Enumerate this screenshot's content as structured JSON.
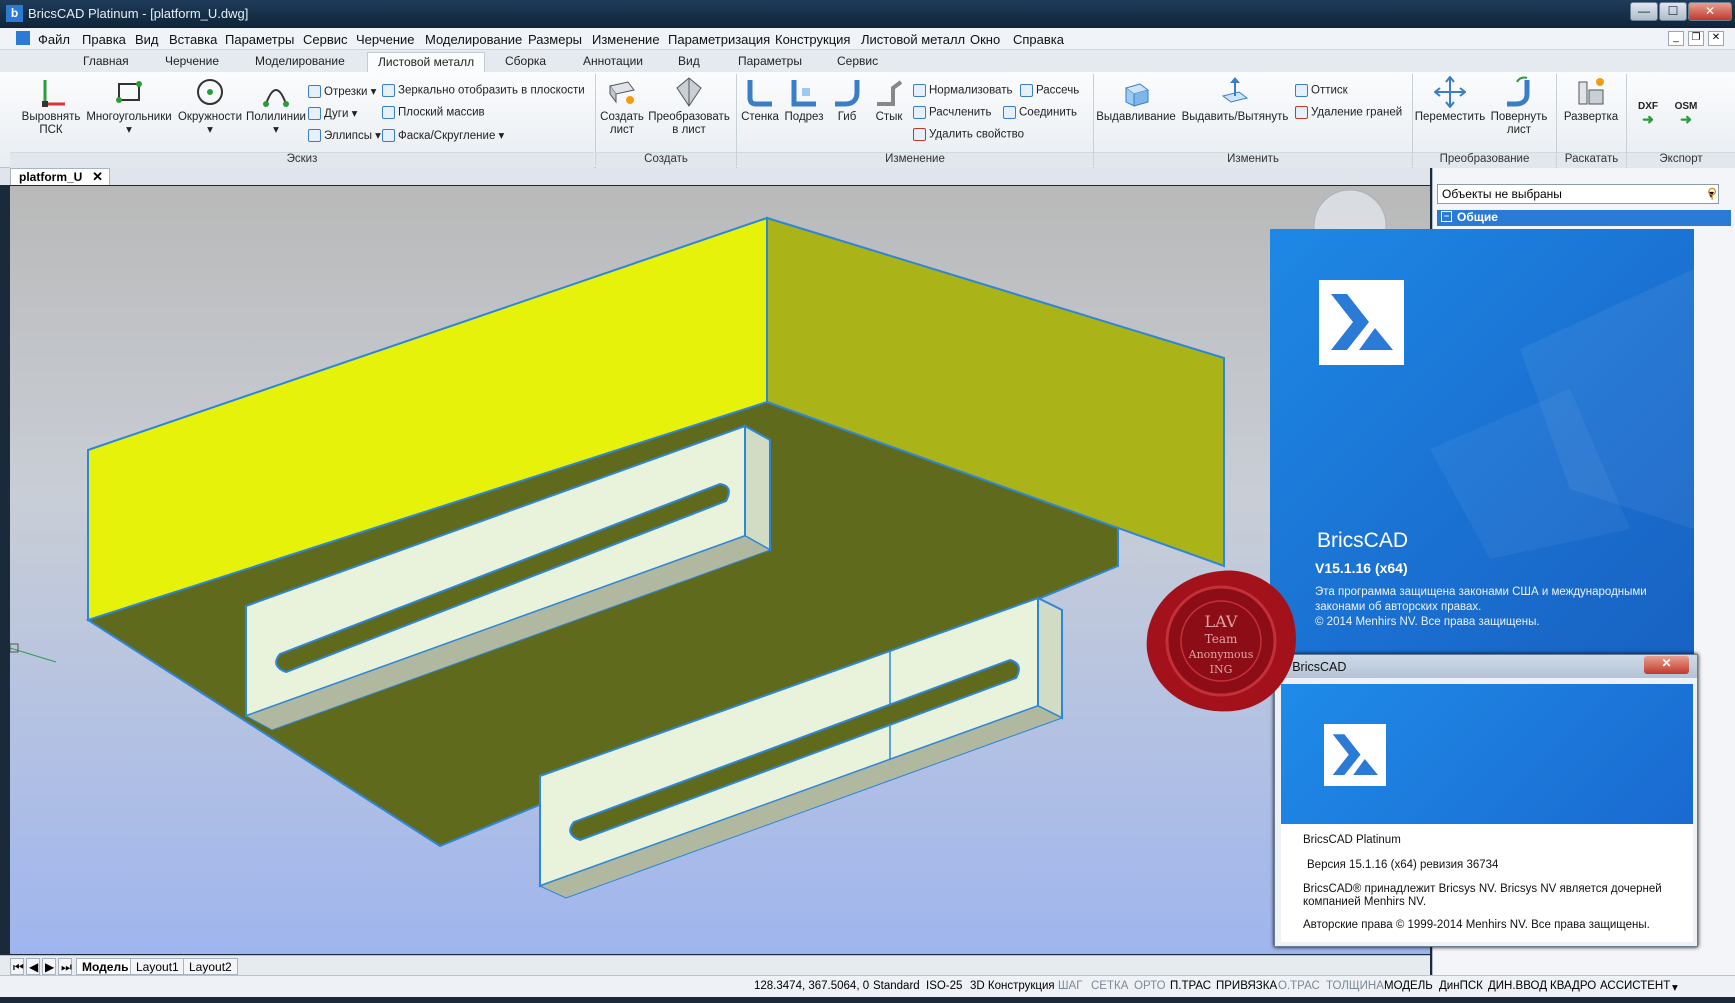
{
  "window": {
    "title": "BricsCAD Platinum - [platform_U.dwg]",
    "min": "—",
    "max": "☐",
    "close": "✕"
  },
  "menu": [
    "Файл",
    "Правка",
    "Вид",
    "Вставка",
    "Параметры",
    "Сервис",
    "Черчение",
    "Моделирование",
    "Размеры",
    "Изменение",
    "Параметризация",
    "Конструкция",
    "Листовой металл",
    "Окно",
    "Справка"
  ],
  "ribbon_tabs": [
    "Главная",
    "Черчение",
    "Моделирование",
    "Листовой металл",
    "Сборка",
    "Аннотации",
    "Вид",
    "Параметры",
    "Сервис"
  ],
  "ribbon": {
    "eskiz": {
      "group": "Эскиз",
      "align": "Выровнять ПСК",
      "polygons": "Многоугольники",
      "circles": "Окружности",
      "polylines": "Полилинии",
      "segments": "Отрезки",
      "arcs": "Дуги",
      "ellipses": "Эллипсы",
      "mirror": "Зеркально отобразить в плоскости",
      "flat_array": "Плоский массив",
      "chamfer": "Фаска/Скругление"
    },
    "create": {
      "group": "Создать",
      "create_sheet": "Создать лист",
      "convert": "Преобразовать в лист"
    },
    "modify": {
      "group": "Изменение",
      "wall": "Стенка",
      "relief": "Подрез",
      "bend": "Гиб",
      "joint": "Стык",
      "normalize": "Нормализовать",
      "split": "Расчленить",
      "delete_prop": "Удалить свойство",
      "rip": "Рассечь",
      "connect": "Соединить"
    },
    "change": {
      "group": "Изменить",
      "extrude": "Выдавливание",
      "pushpull": "Выдавить/Вытянуть",
      "imprint": "Оттиск",
      "delete_faces": "Удаление граней"
    },
    "transform": {
      "group": "Преобразование",
      "move": "Переместить",
      "rotate": "Повернуть лист"
    },
    "unfold": {
      "group": "Раскатать",
      "unfold": "Развертка"
    },
    "export": {
      "group": "Экспорт",
      "dxf": "DXF",
      "osm": "OSM"
    }
  },
  "document_tab": "platform_U",
  "layout_tabs": [
    "Модель",
    "Layout1",
    "Layout2"
  ],
  "status": {
    "coords": "128.3474, 367.5064, 0",
    "style": "Standard",
    "dimstyle": "ISO-25",
    "workspace": "3D Конструкция",
    "toggles": [
      "ШАГ",
      "СЕТКА",
      "ОРТО",
      "П.ТРАС",
      "ПРИВЯЗКА",
      "О.ТРАС",
      "ТОЛЩИНА",
      "МОДЕЛЬ",
      "ДинПСК",
      "ДИН.ВВОД",
      "КВАДРО",
      "АССИСТЕНТ"
    ]
  },
  "panel": {
    "selection": "Объекты не выбраны",
    "section": "Общие"
  },
  "splash": {
    "brand": "BricsCAD",
    "version": "V15.1.16 (x64)",
    "legal1": "Эта программа защищена законами США и международными законами об авторских правах.",
    "legal2": "© 2014 Menhirs NV. Все права защищены."
  },
  "about": {
    "caption": "О BricsCAD",
    "product": "BricsCAD Platinum",
    "version": "Версия 15.1.16 (x64) ревизия 36734",
    "owner": "BricsCAD® принадлежит Bricsys NV. Bricsys NV является дочерней компанией Menhirs NV.",
    "copyright": "Авторские права © 1999-2014 Menhirs NV. Все права защищены."
  },
  "seal": {
    "lines": [
      "LAV",
      "Team",
      "Anonymous",
      "ING"
    ]
  },
  "colors": {
    "accent": "#2b7bd6",
    "model_yellow": "#e6f20a",
    "model_olive": "#aab318",
    "model_dark": "#5f6a1c",
    "model_white": "#e9f3dc"
  }
}
